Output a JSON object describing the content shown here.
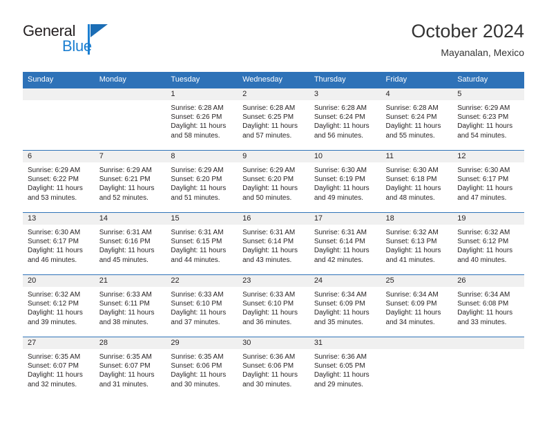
{
  "brand": {
    "name_primary": "General",
    "name_secondary": "Blue",
    "triangle_icon": "triangle-icon",
    "triangle_color": "#1b6db5",
    "text_color": "#231f20",
    "accent_color": "#1c7fd1"
  },
  "header": {
    "title": "October 2024",
    "subtitle": "Mayanalan, Mexico"
  },
  "theme": {
    "header_blue": "#2e72b8",
    "date_strip_gray": "#f0f0f0",
    "cell_background": "#ffffff",
    "text_color": "#231f20"
  },
  "weekday_headers": [
    "Sunday",
    "Monday",
    "Tuesday",
    "Wednesday",
    "Thursday",
    "Friday",
    "Saturday"
  ],
  "weeks": [
    [
      {
        "day": "",
        "sunrise": "",
        "sunset": "",
        "daylight_line1": "",
        "daylight_line2": ""
      },
      {
        "day": "",
        "sunrise": "",
        "sunset": "",
        "daylight_line1": "",
        "daylight_line2": ""
      },
      {
        "day": "1",
        "sunrise": "Sunrise: 6:28 AM",
        "sunset": "Sunset: 6:26 PM",
        "daylight_line1": "Daylight: 11 hours",
        "daylight_line2": "and 58 minutes."
      },
      {
        "day": "2",
        "sunrise": "Sunrise: 6:28 AM",
        "sunset": "Sunset: 6:25 PM",
        "daylight_line1": "Daylight: 11 hours",
        "daylight_line2": "and 57 minutes."
      },
      {
        "day": "3",
        "sunrise": "Sunrise: 6:28 AM",
        "sunset": "Sunset: 6:24 PM",
        "daylight_line1": "Daylight: 11 hours",
        "daylight_line2": "and 56 minutes."
      },
      {
        "day": "4",
        "sunrise": "Sunrise: 6:28 AM",
        "sunset": "Sunset: 6:24 PM",
        "daylight_line1": "Daylight: 11 hours",
        "daylight_line2": "and 55 minutes."
      },
      {
        "day": "5",
        "sunrise": "Sunrise: 6:29 AM",
        "sunset": "Sunset: 6:23 PM",
        "daylight_line1": "Daylight: 11 hours",
        "daylight_line2": "and 54 minutes."
      }
    ],
    [
      {
        "day": "6",
        "sunrise": "Sunrise: 6:29 AM",
        "sunset": "Sunset: 6:22 PM",
        "daylight_line1": "Daylight: 11 hours",
        "daylight_line2": "and 53 minutes."
      },
      {
        "day": "7",
        "sunrise": "Sunrise: 6:29 AM",
        "sunset": "Sunset: 6:21 PM",
        "daylight_line1": "Daylight: 11 hours",
        "daylight_line2": "and 52 minutes."
      },
      {
        "day": "8",
        "sunrise": "Sunrise: 6:29 AM",
        "sunset": "Sunset: 6:20 PM",
        "daylight_line1": "Daylight: 11 hours",
        "daylight_line2": "and 51 minutes."
      },
      {
        "day": "9",
        "sunrise": "Sunrise: 6:29 AM",
        "sunset": "Sunset: 6:20 PM",
        "daylight_line1": "Daylight: 11 hours",
        "daylight_line2": "and 50 minutes."
      },
      {
        "day": "10",
        "sunrise": "Sunrise: 6:30 AM",
        "sunset": "Sunset: 6:19 PM",
        "daylight_line1": "Daylight: 11 hours",
        "daylight_line2": "and 49 minutes."
      },
      {
        "day": "11",
        "sunrise": "Sunrise: 6:30 AM",
        "sunset": "Sunset: 6:18 PM",
        "daylight_line1": "Daylight: 11 hours",
        "daylight_line2": "and 48 minutes."
      },
      {
        "day": "12",
        "sunrise": "Sunrise: 6:30 AM",
        "sunset": "Sunset: 6:17 PM",
        "daylight_line1": "Daylight: 11 hours",
        "daylight_line2": "and 47 minutes."
      }
    ],
    [
      {
        "day": "13",
        "sunrise": "Sunrise: 6:30 AM",
        "sunset": "Sunset: 6:17 PM",
        "daylight_line1": "Daylight: 11 hours",
        "daylight_line2": "and 46 minutes."
      },
      {
        "day": "14",
        "sunrise": "Sunrise: 6:31 AM",
        "sunset": "Sunset: 6:16 PM",
        "daylight_line1": "Daylight: 11 hours",
        "daylight_line2": "and 45 minutes."
      },
      {
        "day": "15",
        "sunrise": "Sunrise: 6:31 AM",
        "sunset": "Sunset: 6:15 PM",
        "daylight_line1": "Daylight: 11 hours",
        "daylight_line2": "and 44 minutes."
      },
      {
        "day": "16",
        "sunrise": "Sunrise: 6:31 AM",
        "sunset": "Sunset: 6:14 PM",
        "daylight_line1": "Daylight: 11 hours",
        "daylight_line2": "and 43 minutes."
      },
      {
        "day": "17",
        "sunrise": "Sunrise: 6:31 AM",
        "sunset": "Sunset: 6:14 PM",
        "daylight_line1": "Daylight: 11 hours",
        "daylight_line2": "and 42 minutes."
      },
      {
        "day": "18",
        "sunrise": "Sunrise: 6:32 AM",
        "sunset": "Sunset: 6:13 PM",
        "daylight_line1": "Daylight: 11 hours",
        "daylight_line2": "and 41 minutes."
      },
      {
        "day": "19",
        "sunrise": "Sunrise: 6:32 AM",
        "sunset": "Sunset: 6:12 PM",
        "daylight_line1": "Daylight: 11 hours",
        "daylight_line2": "and 40 minutes."
      }
    ],
    [
      {
        "day": "20",
        "sunrise": "Sunrise: 6:32 AM",
        "sunset": "Sunset: 6:12 PM",
        "daylight_line1": "Daylight: 11 hours",
        "daylight_line2": "and 39 minutes."
      },
      {
        "day": "21",
        "sunrise": "Sunrise: 6:33 AM",
        "sunset": "Sunset: 6:11 PM",
        "daylight_line1": "Daylight: 11 hours",
        "daylight_line2": "and 38 minutes."
      },
      {
        "day": "22",
        "sunrise": "Sunrise: 6:33 AM",
        "sunset": "Sunset: 6:10 PM",
        "daylight_line1": "Daylight: 11 hours",
        "daylight_line2": "and 37 minutes."
      },
      {
        "day": "23",
        "sunrise": "Sunrise: 6:33 AM",
        "sunset": "Sunset: 6:10 PM",
        "daylight_line1": "Daylight: 11 hours",
        "daylight_line2": "and 36 minutes."
      },
      {
        "day": "24",
        "sunrise": "Sunrise: 6:34 AM",
        "sunset": "Sunset: 6:09 PM",
        "daylight_line1": "Daylight: 11 hours",
        "daylight_line2": "and 35 minutes."
      },
      {
        "day": "25",
        "sunrise": "Sunrise: 6:34 AM",
        "sunset": "Sunset: 6:09 PM",
        "daylight_line1": "Daylight: 11 hours",
        "daylight_line2": "and 34 minutes."
      },
      {
        "day": "26",
        "sunrise": "Sunrise: 6:34 AM",
        "sunset": "Sunset: 6:08 PM",
        "daylight_line1": "Daylight: 11 hours",
        "daylight_line2": "and 33 minutes."
      }
    ],
    [
      {
        "day": "27",
        "sunrise": "Sunrise: 6:35 AM",
        "sunset": "Sunset: 6:07 PM",
        "daylight_line1": "Daylight: 11 hours",
        "daylight_line2": "and 32 minutes."
      },
      {
        "day": "28",
        "sunrise": "Sunrise: 6:35 AM",
        "sunset": "Sunset: 6:07 PM",
        "daylight_line1": "Daylight: 11 hours",
        "daylight_line2": "and 31 minutes."
      },
      {
        "day": "29",
        "sunrise": "Sunrise: 6:35 AM",
        "sunset": "Sunset: 6:06 PM",
        "daylight_line1": "Daylight: 11 hours",
        "daylight_line2": "and 30 minutes."
      },
      {
        "day": "30",
        "sunrise": "Sunrise: 6:36 AM",
        "sunset": "Sunset: 6:06 PM",
        "daylight_line1": "Daylight: 11 hours",
        "daylight_line2": "and 30 minutes."
      },
      {
        "day": "31",
        "sunrise": "Sunrise: 6:36 AM",
        "sunset": "Sunset: 6:05 PM",
        "daylight_line1": "Daylight: 11 hours",
        "daylight_line2": "and 29 minutes."
      },
      {
        "day": "",
        "sunrise": "",
        "sunset": "",
        "daylight_line1": "",
        "daylight_line2": ""
      },
      {
        "day": "",
        "sunrise": "",
        "sunset": "",
        "daylight_line1": "",
        "daylight_line2": ""
      }
    ]
  ]
}
